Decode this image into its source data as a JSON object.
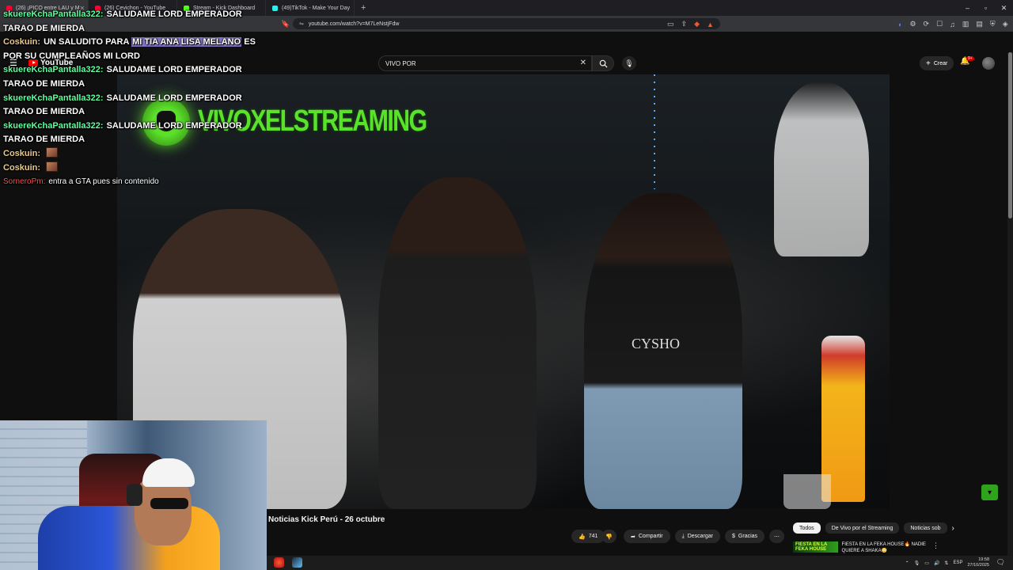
{
  "browser": {
    "tabs": [
      {
        "label": "(26) ¡PICO entre LAU y M",
        "color": "#ff0033",
        "active": true
      },
      {
        "label": "(26) Cevichon - YouTube",
        "color": "#ff0033",
        "active": false
      },
      {
        "label": "Stream - Kick Dashboard",
        "color": "#53fc18",
        "active": false
      },
      {
        "label": "(49)TikTok - Make Your Day",
        "color": "#25f4ee",
        "active": false
      }
    ],
    "new_tab": "+",
    "url": "youtube.com/watch?v=M7LeNstjFdw"
  },
  "youtube": {
    "logo": "YouTube",
    "search_value": "VIVO POR",
    "create_label": "Crear",
    "notification_count": "9+",
    "video_title": "Noticias Kick Perú - 26 octubre",
    "likes": "741",
    "share_label": "Compartir",
    "download_label": "Descargar",
    "thanks_label": "Gracias",
    "chips": [
      "Todos",
      "De Vivo por el Streaming",
      "Noticias sob"
    ],
    "reco": {
      "thumb_text": "FIESTA EN LA FEKA HOUSE",
      "title": "FIESTA EN LA FEKA HOUSE🔥 NADIE QUIERE A SHAKA😳"
    }
  },
  "video": {
    "brand_text": "VIVOXELSTREAMING",
    "shirt_text": "CYSHO"
  },
  "chat": [
    {
      "user": "skuereKchaPantalla322:",
      "color": "#5cff9c",
      "text": "SALUDAME LORD EMPERADOR TARAO DE MIERDA"
    },
    {
      "user": "Coskuin:",
      "color": "#e9c98a",
      "text_pre": "UN SALUDITO PARA ",
      "text_hl": "MI TIA ANA LISA MELANO",
      "text_post": " ES POR SU CUMPLEAÑOS MI LORD"
    },
    {
      "user": "skuereKchaPantalla322:",
      "color": "#5cff9c",
      "text": "SALUDAME LORD EMPERADOR TARAO DE MIERDA"
    },
    {
      "user": "skuereKchaPantalla322:",
      "color": "#5cff9c",
      "text": "SALUDAME LORD EMPERADOR TARAO DE MIERDA"
    },
    {
      "user": "skuereKchaPantalla322:",
      "color": "#5cff9c",
      "text": "SALUDAME LORD EMPERADOR TARAO DE MIERDA"
    },
    {
      "user": "Coskuin:",
      "color": "#e9c98a",
      "emote": true
    },
    {
      "user": "Coskuin:",
      "color": "#e9c98a",
      "emote": true
    },
    {
      "user": "SorneroPm:",
      "color": "#ff4d4d",
      "text": "entra a GTA pues sin contenido"
    }
  ],
  "taskbar": {
    "language": "ESP",
    "time": "19:58",
    "date": "27/10/2025"
  }
}
